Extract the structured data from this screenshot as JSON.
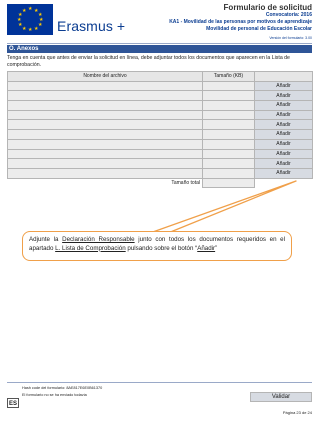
{
  "header": {
    "logo_text": "Erasmus +",
    "form_title": "Formulario de solicitud",
    "call": "Convocatoria: 2016",
    "action": "KA1 - Movilidad de las personas por motivos de aprendizaje",
    "subaction": "Movilidad de personal de Educación Escolar",
    "version": "Versión del formulario: 3.00"
  },
  "section": {
    "title": "O. Anexos",
    "intro": "Tenga en cuenta que antes de enviar la solicitud en línea, debe adjuntar todos los documentos que aparecen en la Lista de comprobación."
  },
  "table": {
    "col_name": "Nombre del archivo",
    "col_size": "Tamaño (KB)",
    "rows": [
      {
        "name": "",
        "size": "",
        "button": "Añadir"
      },
      {
        "name": "",
        "size": "",
        "button": "Añadir"
      },
      {
        "name": "",
        "size": "",
        "button": "Añadir"
      },
      {
        "name": "",
        "size": "",
        "button": "Añadir"
      },
      {
        "name": "",
        "size": "",
        "button": "Añadir"
      },
      {
        "name": "",
        "size": "",
        "button": "Añadir"
      },
      {
        "name": "",
        "size": "",
        "button": "Añadir"
      },
      {
        "name": "",
        "size": "",
        "button": "Añadir"
      },
      {
        "name": "",
        "size": "",
        "button": "Añadir"
      },
      {
        "name": "",
        "size": "",
        "button": "Añadir"
      }
    ],
    "total_label": "Tamaño total"
  },
  "callout": {
    "prefix": "Adjunte la ",
    "link1": "Declaración Responsable",
    "middle": " junto con todos los documentos requeridos en el apartado ",
    "link2": "L. Lista de Comprobación",
    "middle2": " pulsando sobre el botón “",
    "link3": "Añadir",
    "suffix": "”"
  },
  "footer": {
    "hash": "Hash code del formulario: 8AE817E6E0B61370",
    "notice": "El formulario no se ha enviado todavía",
    "language": "ES",
    "validate_label": "Validar",
    "page": "Página 23 de 24"
  },
  "colors": {
    "section_bar": "#2f5597",
    "callout_border": "#f0a04a",
    "eu_blue": "#003399",
    "eu_yellow": "#ffcc00"
  }
}
